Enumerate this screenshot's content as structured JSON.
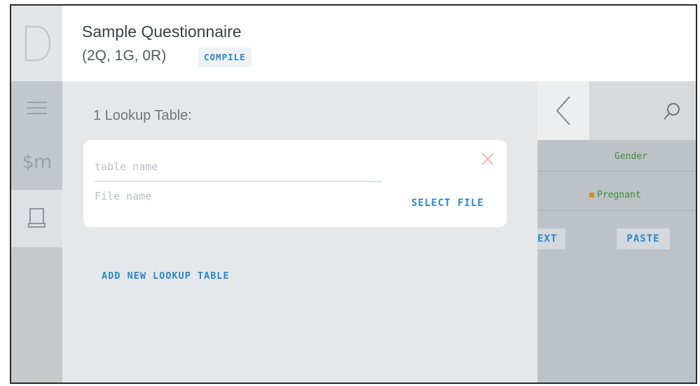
{
  "app": {
    "logo_letter": "D"
  },
  "header": {
    "title": "Sample Questionnaire",
    "subtitle": "(2Q, 1G, 0R)",
    "compile_label": "COMPILE"
  },
  "sidebar": {
    "items": [
      {
        "name": "menu",
        "icon": "hamburger-menu-icon"
      },
      {
        "name": "sm",
        "label": "$m"
      },
      {
        "name": "lookup",
        "icon": "book-icon",
        "active": true
      }
    ]
  },
  "lookup_panel": {
    "heading": "1 Lookup Table:",
    "table": {
      "name_placeholder": "table name",
      "file_placeholder": "File name",
      "select_file_label": "SELECT FILE"
    },
    "add_new_label": "ADD NEW LOOKUP TABLE"
  },
  "right_panel": {
    "tags": [
      "Gender",
      "Pregnant"
    ],
    "buttons": [
      "EXT",
      "PASTE"
    ]
  },
  "colors": {
    "accent": "#2f86c7",
    "tag_green": "#3d8f3a",
    "tag_dot": "#d18a1f",
    "clear_x": "#f4b6b6"
  }
}
